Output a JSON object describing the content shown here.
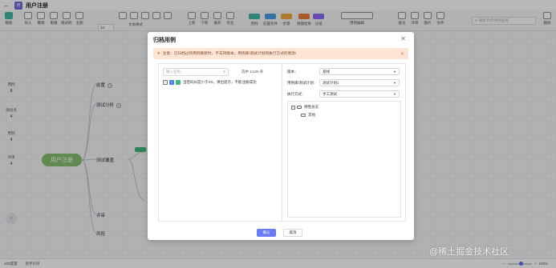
{
  "header": {
    "back_icon": "arrow-left-icon",
    "logo_text": "用",
    "title": "用户注册"
  },
  "toolbar": {
    "font_size": "14",
    "items": [
      {
        "label": "模板"
      },
      {
        "label": "导入"
      },
      {
        "label": "撤销"
      },
      {
        "label": "重做"
      },
      {
        "label": "格式刷"
      },
      {
        "label": "主题"
      }
    ],
    "text_style_label": "文本样式",
    "move": [
      {
        "label": "上移"
      },
      {
        "label": "下移"
      },
      {
        "label": "展开"
      },
      {
        "label": "优化"
      }
    ],
    "chips": [
      {
        "label": "用例",
        "color": "#3fb8a6"
      },
      {
        "label": "前置条件",
        "color": "#4aa0e8"
      },
      {
        "label": "步骤",
        "color": "#f0a93e"
      },
      {
        "label": "预期结果",
        "color": "#f07a3a"
      },
      {
        "label": "分组",
        "color": "#8e6af0"
      }
    ],
    "case_edit_label": "用例编辑",
    "right": [
      {
        "label": "备注"
      },
      {
        "label": "评审"
      },
      {
        "label": "图片"
      },
      {
        "label": "文件"
      }
    ],
    "search_placeholder": "搜索节点/用例名称",
    "delete_label": "删除"
  },
  "sidebar": {
    "counters": [
      {
        "label": "用例",
        "value": "8"
      },
      {
        "label": "测试点",
        "value": "4"
      },
      {
        "label": "用例",
        "value": "4"
      },
      {
        "label": "评审",
        "value": "4"
      }
    ]
  },
  "mindmap": {
    "root": "用户注册",
    "children": [
      {
        "label": "前置"
      },
      {
        "label": "测试分析"
      },
      {
        "label": "测试覆盖"
      },
      {
        "label": "评审"
      },
      {
        "label": "风险"
      }
    ]
  },
  "statusbar": {
    "tabs": [
      "100度量",
      "新手引导"
    ],
    "zoom_label": "100%"
  },
  "dialog": {
    "title": "归档用例",
    "notice": "注意：已归档过的用例要新时，不支持版本，用例库/测试计划和执行方式的更改!",
    "search_placeholder": "输入名称...",
    "selected_count": "选中 1/100 条",
    "case_item": "当密码长度小于XX，弹出提示，不能注册成功",
    "form": {
      "version_label": "版本：",
      "version_value": "基线",
      "library_label": "用例库/测试计划：",
      "library_value": "测试计划1",
      "exec_label": "执行方式：",
      "exec_value": "手工测试"
    },
    "tree": {
      "root": "特性总览",
      "child": "其他"
    },
    "confirm_label": "确认",
    "cancel_label": "取消"
  },
  "watermark": "@稀土掘金技术社区"
}
